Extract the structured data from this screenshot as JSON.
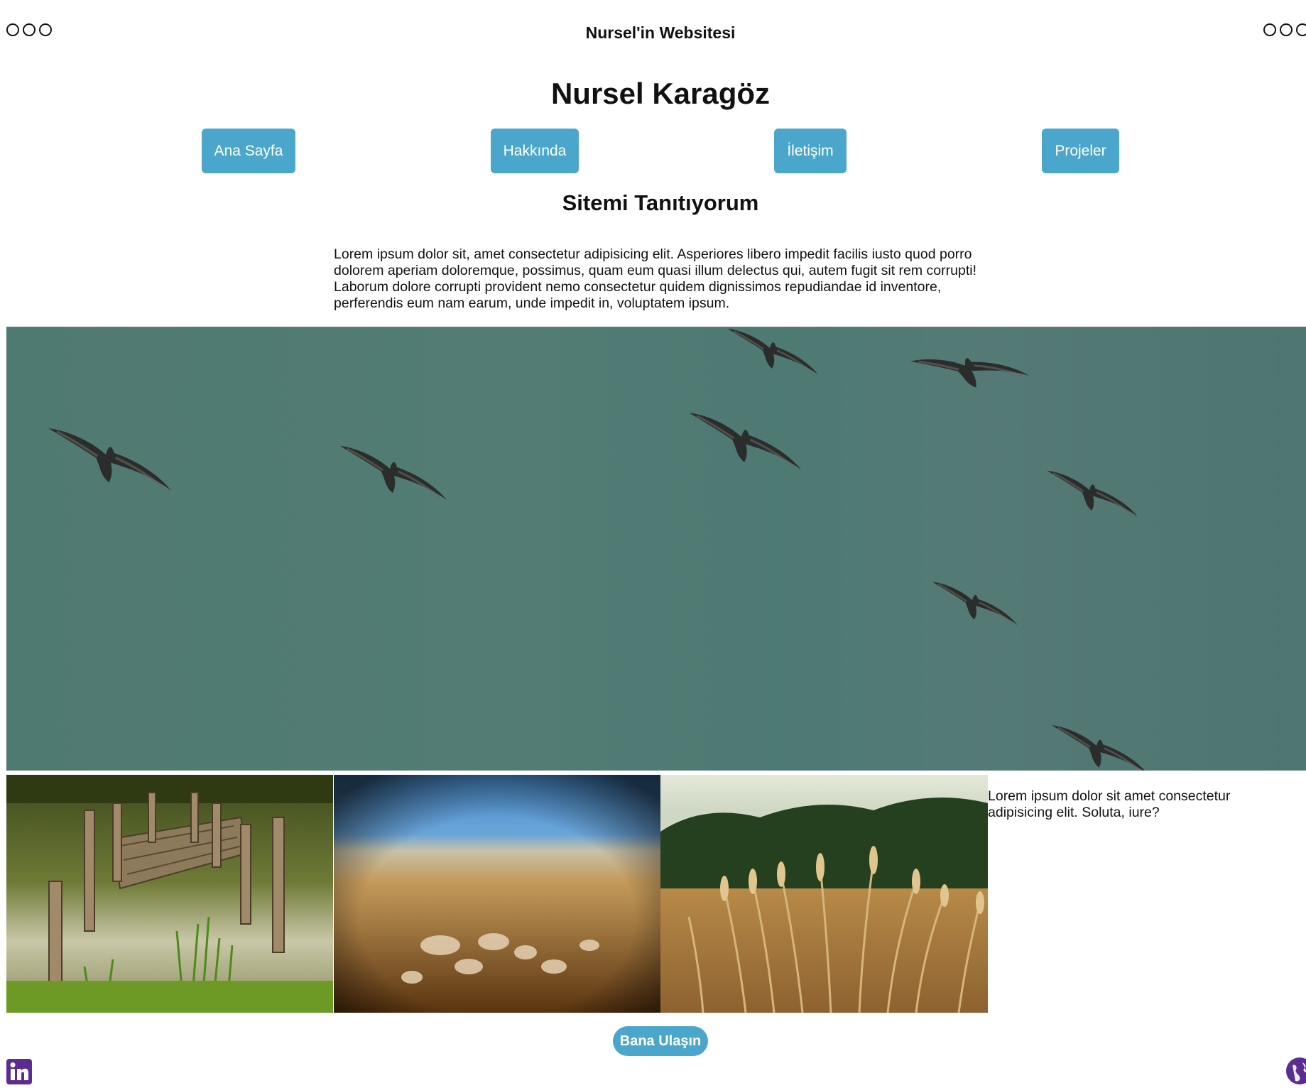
{
  "header": {
    "site_title": "Nursel'in Websitesi",
    "page_title": "Nursel Karagöz"
  },
  "nav": {
    "items": [
      {
        "label": "Ana Sayfa"
      },
      {
        "label": "Hakkında"
      },
      {
        "label": "İletişim"
      },
      {
        "label": "Projeler"
      }
    ]
  },
  "intro": {
    "title": "Sitemi Tanıtıyorum",
    "text": "Lorem ipsum dolor sit, amet consectetur adipisicing elit. Asperiores libero impedit facilis iusto quod porro dolorem aperiam doloremque, possimus, quam eum quasi illum delectus qui, autem fugit sit rem corrupti! Laborum dolore corrupti provident nemo consectetur quidem dignissimos repudiandae id inventore, perferendis eum nam earum, unde impedit in, voluptatem ipsum."
  },
  "gallery": {
    "side_text": "Lorem ipsum dolor sit amet consectetur adipisicing elit. Soluta, iure?"
  },
  "footer": {
    "contact_label": "Bana Ulaşın"
  },
  "icons": {
    "linkedin": "linkedin-icon",
    "globe": "globe-icon"
  },
  "colors": {
    "accent": "#4aa6cb",
    "social": "#5b2d91"
  }
}
